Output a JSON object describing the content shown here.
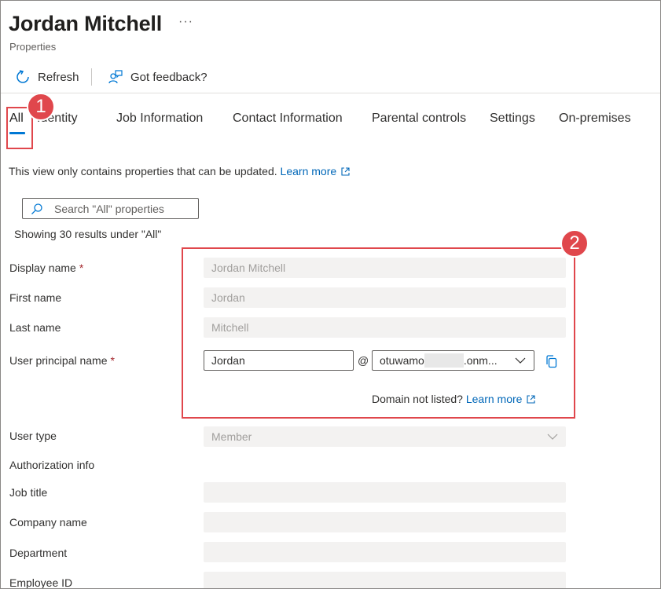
{
  "header": {
    "title": "Jordan Mitchell",
    "more_label": "···",
    "subtitle": "Properties"
  },
  "commands": {
    "refresh_label": "Refresh",
    "feedback_label": "Got feedback?"
  },
  "tabs": [
    {
      "label": "All",
      "active": true
    },
    {
      "label": "Identity"
    },
    {
      "label": "Job Information"
    },
    {
      "label": "Contact Information"
    },
    {
      "label": "Parental controls"
    },
    {
      "label": "Settings"
    },
    {
      "label": "On-premises"
    }
  ],
  "callouts": {
    "one": "1",
    "two": "2"
  },
  "info": {
    "text": "This view only contains properties that can be updated.",
    "link": "Learn more"
  },
  "search": {
    "placeholder": "Search \"All\" properties"
  },
  "results_text": "Showing 30 results under \"All\"",
  "required_mark": "*",
  "form": {
    "display_name": {
      "label": "Display name",
      "value": "Jordan Mitchell"
    },
    "first_name": {
      "label": "First name",
      "value": "Jordan"
    },
    "last_name": {
      "label": "Last name",
      "value": "Mitchell"
    },
    "upn": {
      "label": "User principal name",
      "user": "Jordan",
      "at": "@",
      "domain_prefix": "otuwamo",
      "domain_suffix": ".onm..."
    },
    "domain_note": {
      "text": "Domain not listed?",
      "link": "Learn more"
    },
    "user_type": {
      "label": "User type",
      "value": "Member"
    },
    "authorization_info": {
      "label": "Authorization info"
    },
    "job_title": {
      "label": "Job title",
      "value": ""
    },
    "company_name": {
      "label": "Company name",
      "value": ""
    },
    "department": {
      "label": "Department",
      "value": ""
    },
    "employee_id": {
      "label": "Employee ID",
      "value": ""
    }
  },
  "colors": {
    "accent": "#0078d4",
    "link": "#0067b8",
    "callout": "#e0474c",
    "required": "#a4262c"
  }
}
